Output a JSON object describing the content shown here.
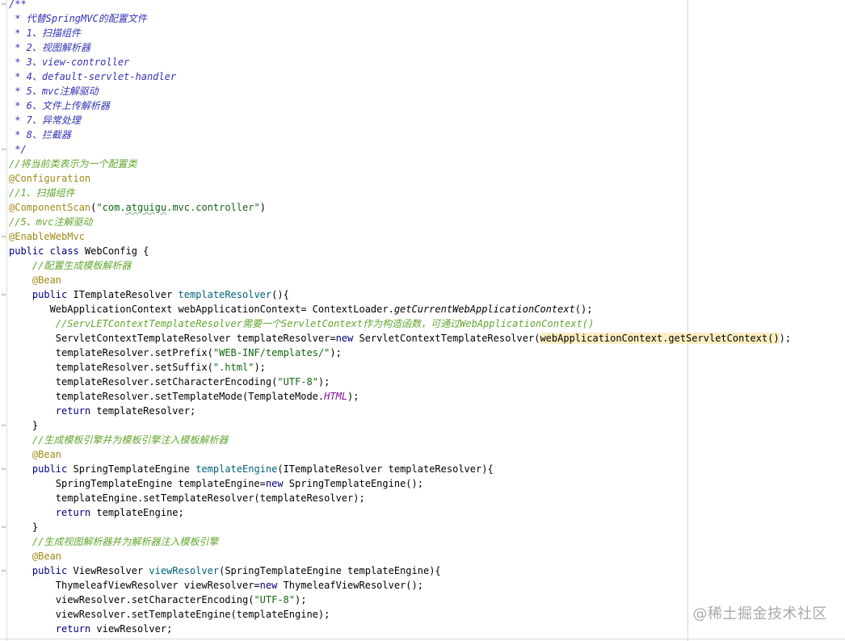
{
  "editor": {
    "lines": [
      {
        "fold": true,
        "tokens": [
          [
            "doc",
            "/**"
          ]
        ]
      },
      {
        "fold": false,
        "tokens": [
          [
            "doc",
            " * 代替SpringMVC的配置文件"
          ]
        ]
      },
      {
        "fold": false,
        "tokens": [
          [
            "doc",
            " * 1、扫描组件"
          ]
        ]
      },
      {
        "fold": false,
        "tokens": [
          [
            "doc",
            " * 2、视图解析器"
          ]
        ]
      },
      {
        "fold": false,
        "tokens": [
          [
            "doc",
            " * 3、view-controller"
          ]
        ]
      },
      {
        "fold": false,
        "tokens": [
          [
            "doc",
            " * 4、default-servlet-handler"
          ]
        ]
      },
      {
        "fold": false,
        "tokens": [
          [
            "doc",
            " * 5、mvc注解驱动"
          ]
        ]
      },
      {
        "fold": false,
        "tokens": [
          [
            "doc",
            " * 6、文件上传解析器"
          ]
        ]
      },
      {
        "fold": false,
        "tokens": [
          [
            "doc",
            " * 7、异常处理"
          ]
        ]
      },
      {
        "fold": false,
        "tokens": [
          [
            "doc",
            " * 8、拦截器"
          ]
        ]
      },
      {
        "fold": true,
        "tokens": [
          [
            "doc",
            " */"
          ]
        ]
      },
      {
        "fold": false,
        "tokens": [
          [
            "cmt",
            "//将当前类表示为一个配置类"
          ]
        ]
      },
      {
        "fold": false,
        "tokens": [
          [
            "ann",
            "@Configuration"
          ]
        ]
      },
      {
        "fold": false,
        "tokens": [
          [
            "cmt",
            "//1、扫描组件"
          ]
        ]
      },
      {
        "fold": false,
        "tokens": [
          [
            "ann",
            "@ComponentScan"
          ],
          [
            "",
            "("
          ],
          [
            "str",
            "\"com."
          ],
          [
            "str squig",
            "atguigu"
          ],
          [
            "str",
            ".mvc.controller\""
          ],
          [
            "",
            ")"
          ]
        ]
      },
      {
        "fold": false,
        "tokens": [
          [
            "cmt",
            "//5、mvc注解驱动"
          ]
        ]
      },
      {
        "fold": true,
        "tokens": [
          [
            "ann",
            "@EnableWebMvc"
          ]
        ]
      },
      {
        "fold": false,
        "tokens": [
          [
            "kw",
            "public class "
          ],
          [
            "",
            "WebConfig {"
          ]
        ]
      },
      {
        "fold": false,
        "tokens": [
          [
            "",
            "    "
          ],
          [
            "cmt",
            "//配置生成模板解析器"
          ]
        ]
      },
      {
        "fold": false,
        "tokens": [
          [
            "",
            "    "
          ],
          [
            "ann",
            "@Bean"
          ]
        ]
      },
      {
        "fold": true,
        "tokens": [
          [
            "",
            "    "
          ],
          [
            "kw",
            "public "
          ],
          [
            "",
            "ITemplateResolver "
          ],
          [
            "mth",
            "templateResolver"
          ],
          [
            "",
            "(){"
          ]
        ]
      },
      {
        "fold": false,
        "tokens": [
          [
            "",
            "       WebApplicationContext webApplicationContext= ContextLoader."
          ],
          [
            "ital",
            "getCurrentWebApplicationContext"
          ],
          [
            "",
            "();"
          ]
        ]
      },
      {
        "fold": false,
        "tokens": [
          [
            "",
            "        "
          ],
          [
            "cmt",
            "//ServLETContextTemplateResolver需要一个ServletContext作为构造函数，可通过WebApplicationContext()"
          ]
        ]
      },
      {
        "fold": false,
        "tokens": [
          [
            "",
            "        ServletContextTemplateResolver templateResolver="
          ],
          [
            "kw",
            "new "
          ],
          [
            "",
            "ServletContextTemplateResolver("
          ],
          [
            "hl",
            "webApplicationContext.getServletContext()"
          ],
          [
            "",
            ");"
          ]
        ]
      },
      {
        "fold": false,
        "tokens": [
          [
            "",
            "        templateResolver.setPrefix("
          ],
          [
            "str",
            "\"WEB-INF/templates/\""
          ],
          [
            "",
            ");"
          ]
        ]
      },
      {
        "fold": false,
        "tokens": [
          [
            "",
            "        templateResolver.setSuffix("
          ],
          [
            "str",
            "\".html\""
          ],
          [
            "",
            ");"
          ]
        ]
      },
      {
        "fold": false,
        "tokens": [
          [
            "",
            "        templateResolver.setCharacterEncoding("
          ],
          [
            "str",
            "\"UTF-8\""
          ],
          [
            "",
            ");"
          ]
        ]
      },
      {
        "fold": false,
        "tokens": [
          [
            "",
            "        templateResolver.setTemplateMode(TemplateMode."
          ],
          [
            "cst",
            "HTML"
          ],
          [
            "",
            ");"
          ]
        ]
      },
      {
        "fold": false,
        "tokens": [
          [
            "",
            "        "
          ],
          [
            "kw",
            "return "
          ],
          [
            "",
            "templateResolver;"
          ]
        ]
      },
      {
        "fold": true,
        "tokens": [
          [
            "",
            "    }"
          ]
        ]
      },
      {
        "fold": false,
        "tokens": [
          [
            "",
            "    "
          ],
          [
            "cmt",
            "//生成模板引擎并为模板引擎注入模板解析器"
          ]
        ]
      },
      {
        "fold": false,
        "tokens": [
          [
            "",
            "    "
          ],
          [
            "ann",
            "@Bean"
          ]
        ]
      },
      {
        "fold": true,
        "tokens": [
          [
            "",
            "    "
          ],
          [
            "kw",
            "public "
          ],
          [
            "",
            "SpringTemplateEngine "
          ],
          [
            "mth",
            "templateEngine"
          ],
          [
            "",
            "(ITemplateResolver templateResolver){"
          ]
        ]
      },
      {
        "fold": false,
        "tokens": [
          [
            "",
            "        SpringTemplateEngine templateEngine="
          ],
          [
            "kw",
            "new "
          ],
          [
            "",
            "SpringTemplateEngine();"
          ]
        ]
      },
      {
        "fold": false,
        "tokens": [
          [
            "",
            "        templateEngine.setTemplateResolver(templateResolver);"
          ]
        ]
      },
      {
        "fold": false,
        "tokens": [
          [
            "",
            "        "
          ],
          [
            "kw",
            "return "
          ],
          [
            "",
            "templateEngine;"
          ]
        ]
      },
      {
        "fold": true,
        "tokens": [
          [
            "",
            "    }"
          ]
        ]
      },
      {
        "fold": false,
        "tokens": [
          [
            "",
            "    "
          ],
          [
            "cmt",
            "//生成视图解析器并为解析器注入模板引擎"
          ]
        ]
      },
      {
        "fold": false,
        "tokens": [
          [
            "",
            "    "
          ],
          [
            "ann",
            "@Bean"
          ]
        ]
      },
      {
        "fold": true,
        "tokens": [
          [
            "",
            "    "
          ],
          [
            "kw",
            "public "
          ],
          [
            "",
            "ViewResolver "
          ],
          [
            "mth",
            "viewResolver"
          ],
          [
            "",
            "(SpringTemplateEngine templateEngine){"
          ]
        ]
      },
      {
        "fold": false,
        "tokens": [
          [
            "",
            "        ThymeleafViewResolver viewResolver="
          ],
          [
            "kw",
            "new "
          ],
          [
            "",
            "ThymeleafViewResolver();"
          ]
        ]
      },
      {
        "fold": false,
        "tokens": [
          [
            "",
            "        viewResolver.setCharacterEncoding("
          ],
          [
            "str",
            "\"UTF-8\""
          ],
          [
            "",
            ");"
          ]
        ]
      },
      {
        "fold": false,
        "tokens": [
          [
            "",
            "        viewResolver.setTemplateEngine(templateEngine);"
          ]
        ]
      },
      {
        "fold": false,
        "tokens": [
          [
            "",
            "        "
          ],
          [
            "kw",
            "return "
          ],
          [
            "",
            "viewResolver;"
          ]
        ]
      }
    ]
  },
  "watermark": "@稀土掘金技术社区"
}
